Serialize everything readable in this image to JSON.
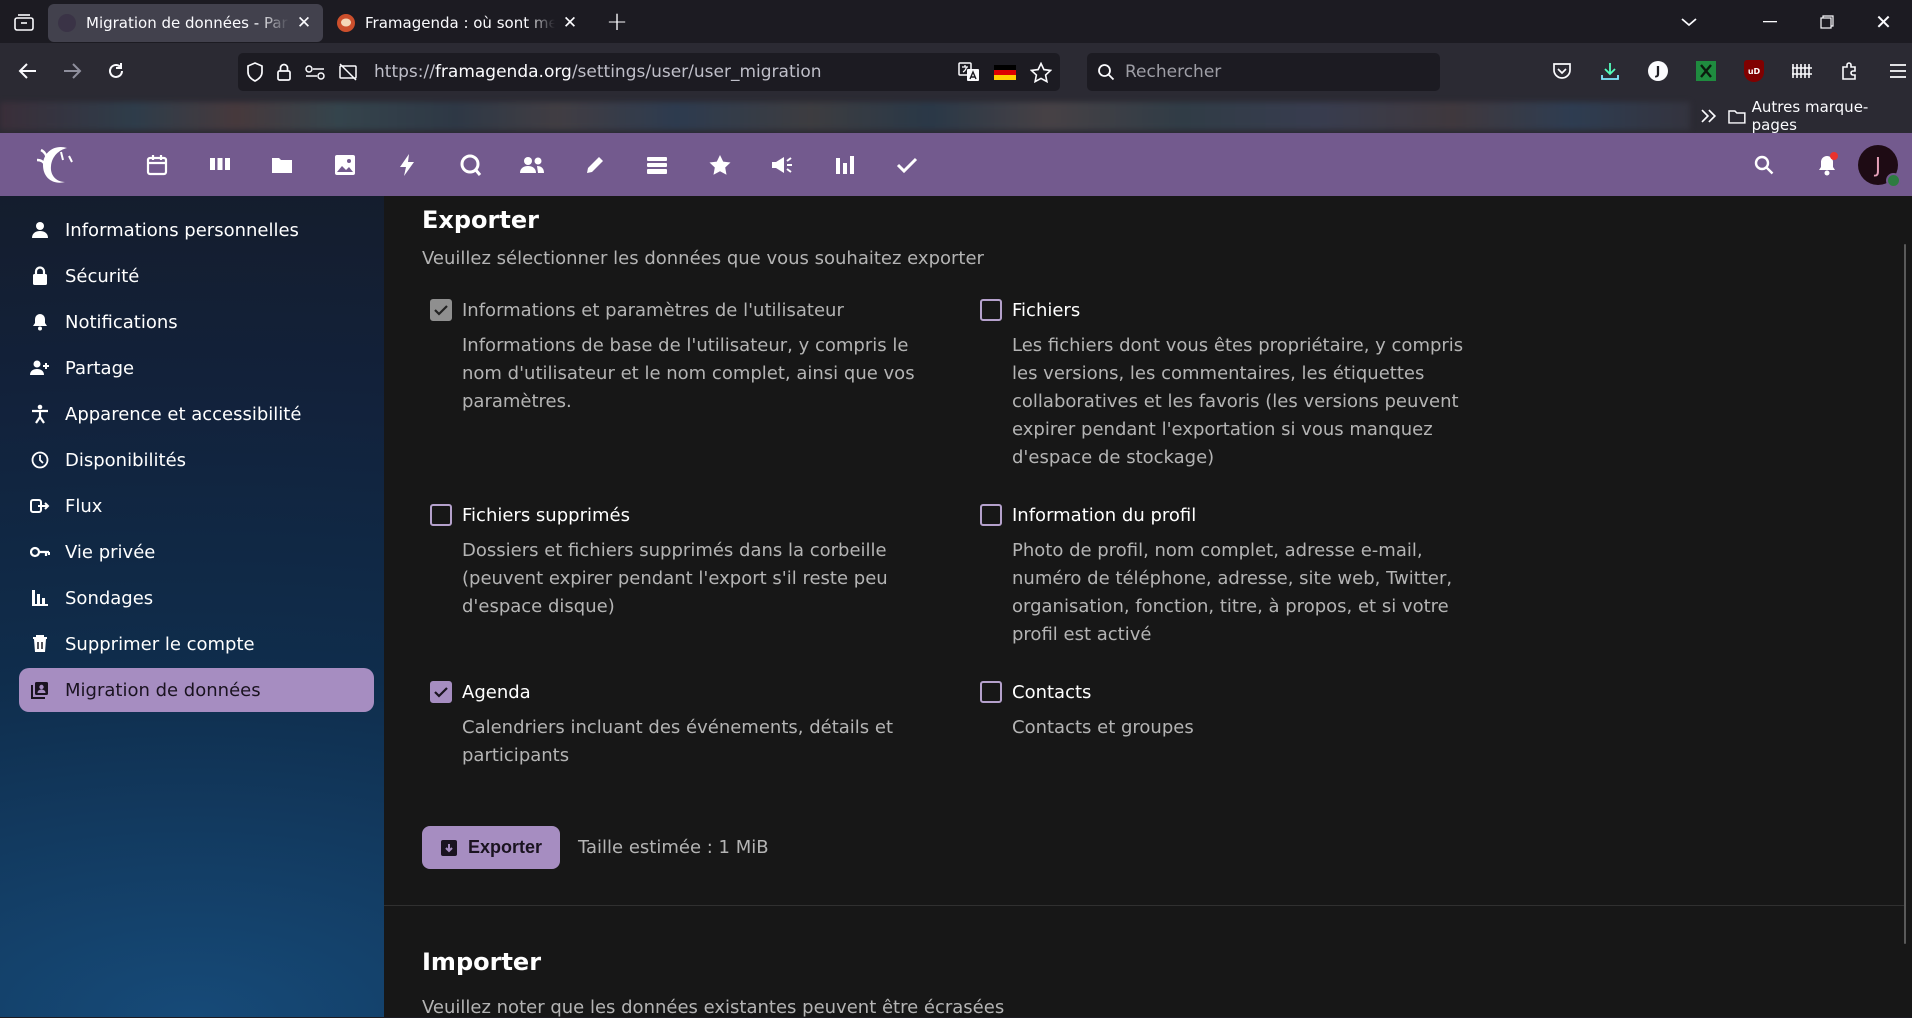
{
  "browser": {
    "tabs": [
      {
        "title": "Migration de données - Paramètres - Framagenda",
        "active": true
      },
      {
        "title": "Framagenda : où sont mes données",
        "active": false
      }
    ],
    "url_prefix": "https://",
    "url_domain": "framagenda.org",
    "url_path": "/settings/user/user_migration",
    "search_placeholder": "Rechercher",
    "bookmarks_folder": "Autres marque-pages",
    "extension_j_label": "J",
    "extension_ublock_label": "uD"
  },
  "nextcloud": {
    "brand_color": "#735a8e",
    "accent_color": "#a68dc1",
    "avatar_initial": "J",
    "app_icons": [
      "calendar-icon",
      "deck-icon",
      "files-icon",
      "photos-icon",
      "activity-icon",
      "talk-icon",
      "contacts-icon",
      "notes-icon",
      "stack-icon",
      "favorites-icon",
      "announcements-icon",
      "polls-icon",
      "tasks-icon"
    ]
  },
  "sidebar": {
    "items": [
      {
        "label": "Informations personnelles",
        "icon": "user-icon"
      },
      {
        "label": "Sécurité",
        "icon": "lock-icon"
      },
      {
        "label": "Notifications",
        "icon": "bell-icon"
      },
      {
        "label": "Partage",
        "icon": "share-icon"
      },
      {
        "label": "Apparence et accessibilité",
        "icon": "accessibility-icon"
      },
      {
        "label": "Disponibilités",
        "icon": "clock-icon"
      },
      {
        "label": "Flux",
        "icon": "flow-icon"
      },
      {
        "label": "Vie privée",
        "icon": "key-icon"
      },
      {
        "label": "Sondages",
        "icon": "poll-icon"
      },
      {
        "label": "Supprimer le compte",
        "icon": "trash-icon"
      },
      {
        "label": "Migration de données",
        "icon": "migration-icon",
        "active": true
      }
    ]
  },
  "export": {
    "title": "Exporter",
    "description": "Veuillez sélectionner les données que vous souhaitez exporter",
    "options": [
      {
        "label": "Informations et paramètres de l'utilisateur",
        "desc": "Informations de base de l'utilisateur, y compris le nom d'utilisateur et le nom complet, ainsi que vos paramètres.",
        "checked": true,
        "disabled": true
      },
      {
        "label": "Fichiers",
        "desc": "Les fichiers dont vous êtes propriétaire, y compris les versions, les commentaires, les étiquettes collaboratives et les favoris (les versions peuvent expirer pendant l'exportation si vous manquez d'espace de stockage)",
        "checked": false
      },
      {
        "label": "Fichiers supprimés",
        "desc": "Dossiers et fichiers supprimés dans la corbeille (peuvent expirer pendant l'export s'il reste peu d'espace disque)",
        "checked": false
      },
      {
        "label": "Information du profil",
        "desc": "Photo de profil, nom complet, adresse e-mail, numéro de téléphone, adresse, site web, Twitter, organisation, fonction, titre, à propos, et si votre profil est activé",
        "checked": false
      },
      {
        "label": "Agenda",
        "desc": "Calendriers incluant des événements, détails et participants",
        "checked": true
      },
      {
        "label": "Contacts",
        "desc": "Contacts et groupes",
        "checked": false
      }
    ],
    "button_label": "Exporter",
    "estimated_size": "Taille estimée : 1 MiB"
  },
  "import": {
    "title": "Importer",
    "description": "Veuillez noter que les données existantes peuvent être écrasées"
  }
}
